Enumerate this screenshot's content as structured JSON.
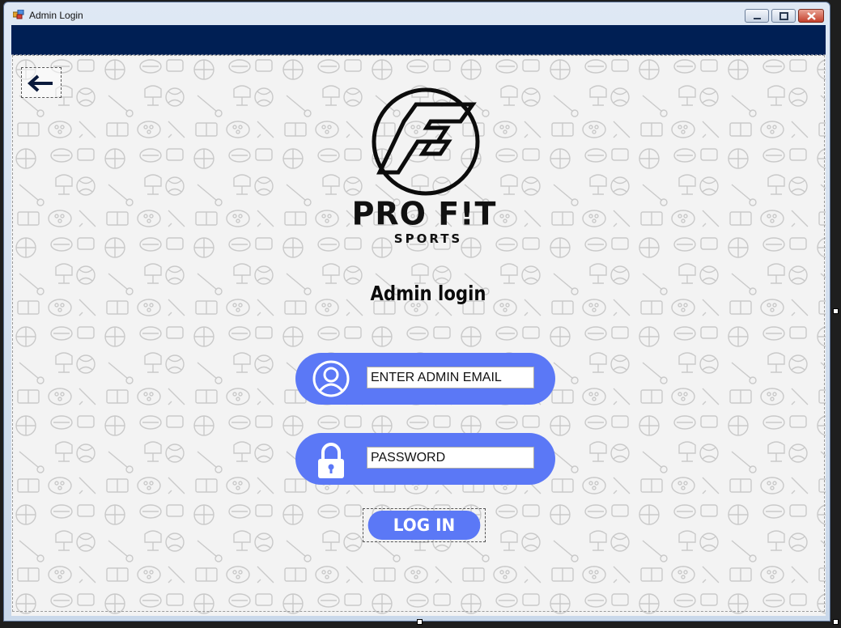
{
  "window": {
    "title": "Admin Login"
  },
  "brand": {
    "name": "PRO F!T",
    "tagline": "SPORTS"
  },
  "page": {
    "heading": "Admin login"
  },
  "form": {
    "email_value": "ENTER ADMIN EMAIL",
    "password_value": "PASSWORD",
    "login_label": "LOG IN"
  },
  "colors": {
    "header": "#001f54",
    "accent": "#5b78f6",
    "background": "#f3f3f3"
  },
  "icons": {
    "back": "arrow-left-icon",
    "user": "user-icon",
    "password": "lock-icon"
  }
}
